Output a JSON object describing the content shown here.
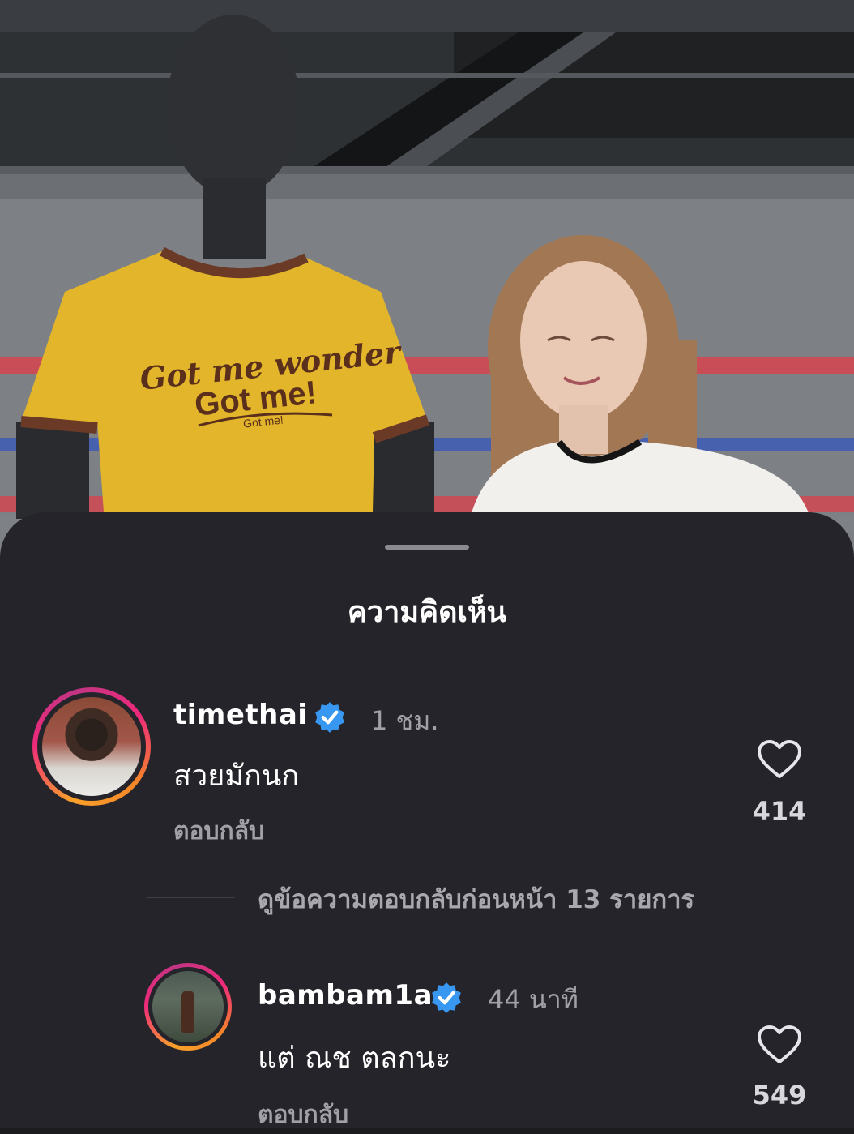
{
  "photo": {
    "shirt_text_line1": "Got me wonder",
    "shirt_text_line2": "Got me!",
    "shirt_text_line3": "Got me!"
  },
  "sheet": {
    "title": "ความคิดเห็น"
  },
  "comments": [
    {
      "username": "timethai",
      "verified": true,
      "time": "1 ชม.",
      "text": "สวยมักนก",
      "reply_label": "ตอบกลับ",
      "likes": "414",
      "icon": "heart-outline-icon"
    },
    {
      "username": "bambam1a",
      "verified": true,
      "time": "44 นาที",
      "text": "แต่ ณช ตลกนะ",
      "reply_label": "ตอบกลับ",
      "likes": "549",
      "icon": "heart-outline-icon"
    }
  ],
  "view_replies": {
    "label": "ดูข้อความตอบกลับก่อนหน้า 13 รายการ"
  },
  "colors": {
    "sheet_bg": "#24242a",
    "verified_blue": "#3897f0",
    "muted_text": "#a0a0a6"
  }
}
